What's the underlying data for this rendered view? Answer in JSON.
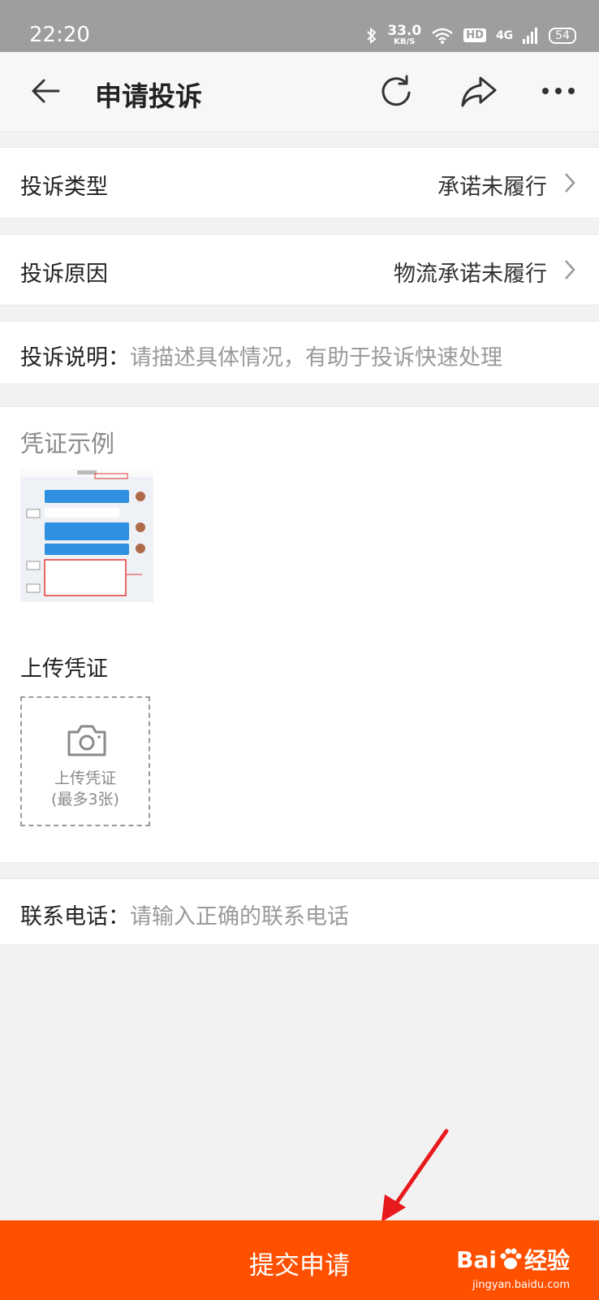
{
  "status_bar": {
    "time": "22:20",
    "net_speed": "33.0",
    "net_unit": "KB/S",
    "hd": "HD",
    "network": "4G",
    "battery": "54",
    "icons": [
      "bluetooth-icon",
      "wifi-icon",
      "signal-icon",
      "battery-icon"
    ]
  },
  "nav": {
    "title": "申请投诉",
    "icons": [
      "back-arrow-icon",
      "refresh-icon",
      "share-icon",
      "more-icon"
    ]
  },
  "form": {
    "complaint_type": {
      "label": "投诉类型",
      "value": "承诺未履行"
    },
    "complaint_reason": {
      "label": "投诉原因",
      "value": "物流承诺未履行"
    },
    "description": {
      "label": "投诉说明：",
      "placeholder": "请描述具体情况，有助于投诉快速处理"
    },
    "evidence_example_title": "凭证示例",
    "upload": {
      "title": "上传凭证",
      "box_line1": "上传凭证",
      "box_line2": "(最多3张)"
    },
    "phone": {
      "label": "联系电话：",
      "placeholder": "请输入正确的联系电话"
    }
  },
  "submit": {
    "label": "提交申请"
  },
  "watermark": {
    "brand": "Bai",
    "brand2": "经验",
    "url": "jingyan.baidu.com"
  },
  "colors": {
    "accent": "#ff5000",
    "annotation_arrow": "#e8191c",
    "statusbar": "#9e9e9e"
  }
}
